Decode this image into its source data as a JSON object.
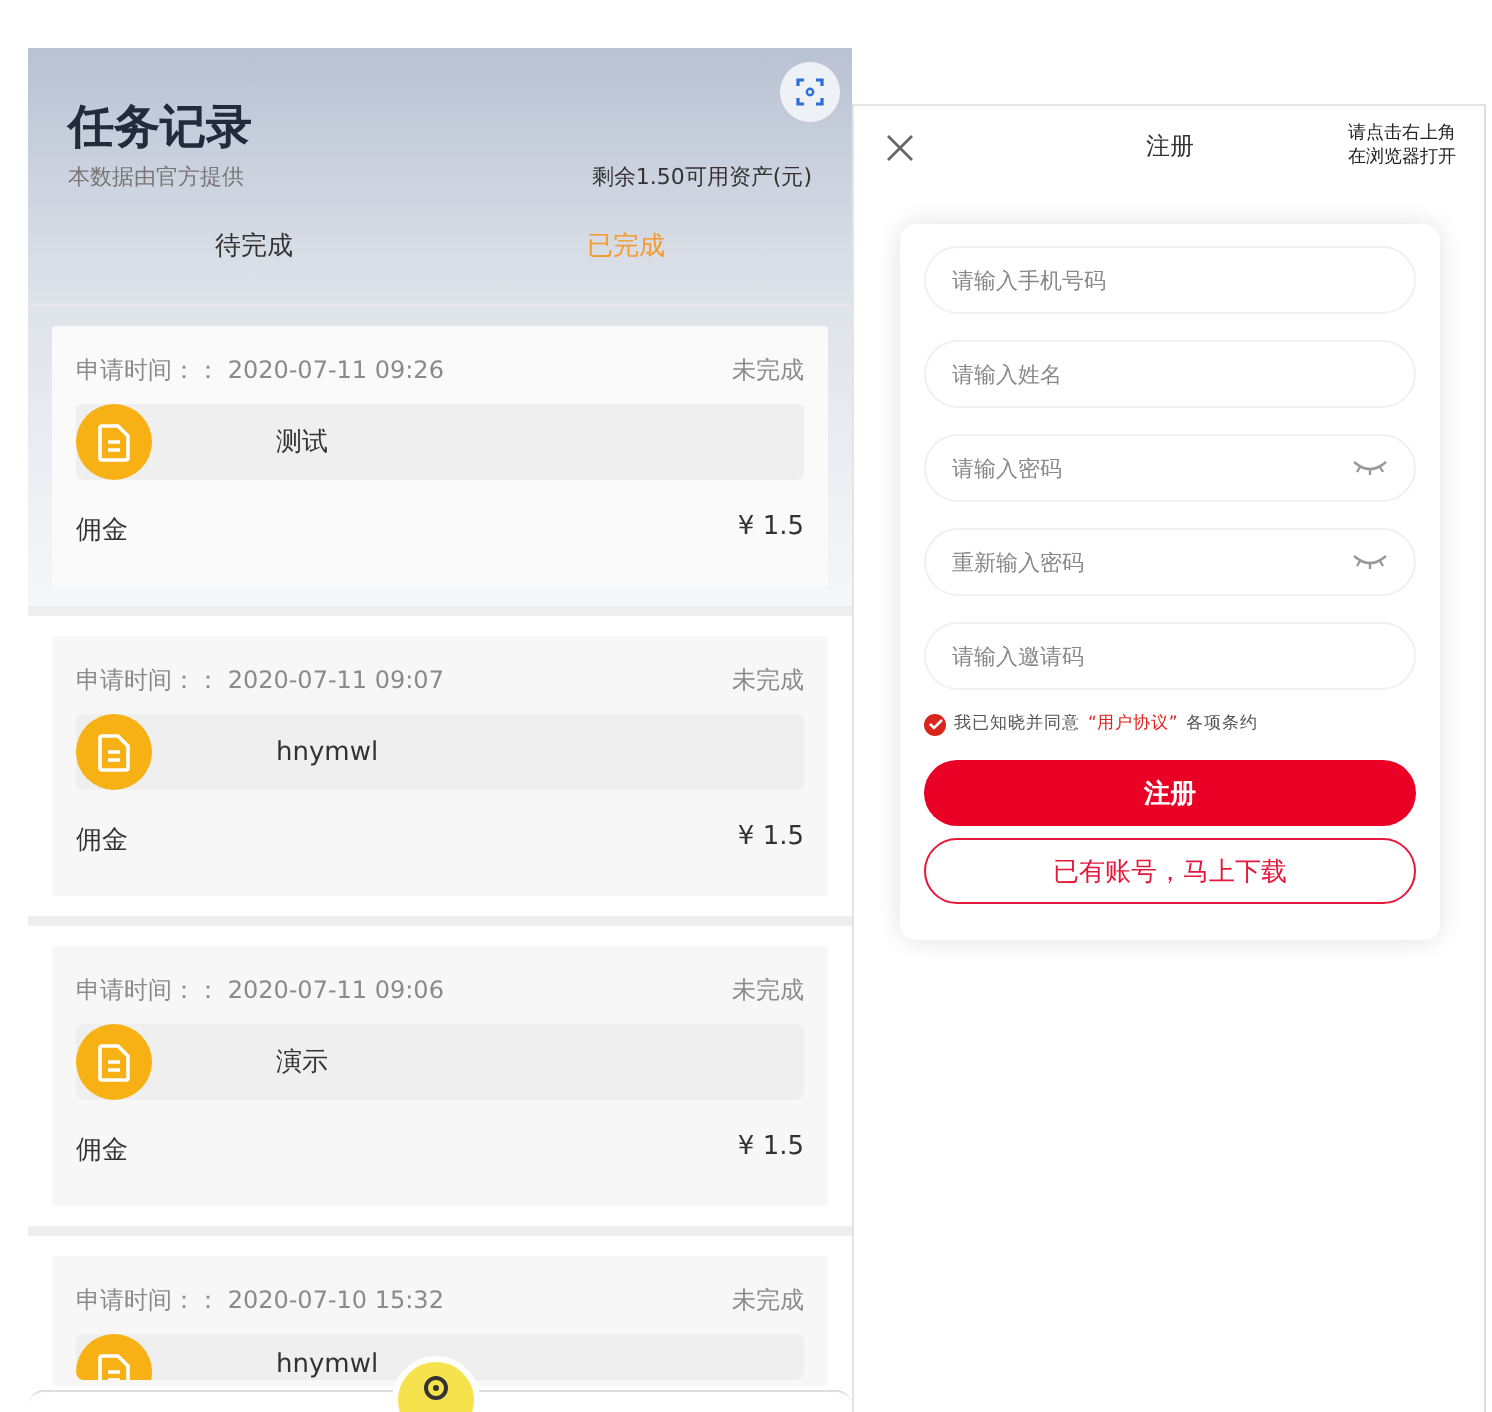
{
  "tasks_screen": {
    "title": "任务记录",
    "subtitle": "本数据由官方提供",
    "balance": "剩余1.50可用资产(元)",
    "tabs": [
      {
        "label": "待完成",
        "selected": false
      },
      {
        "label": "已完成",
        "selected": true
      }
    ],
    "tasks": [
      {
        "time": "申请时间：： 2020-07-11 09:26",
        "status": "未完成",
        "name": "测试",
        "commission_label": "佣金",
        "amount": "¥ 1.5"
      },
      {
        "time": "申请时间：： 2020-07-11 09:07",
        "status": "未完成",
        "name": "hnymwl",
        "commission_label": "佣金",
        "amount": "¥ 1.5"
      },
      {
        "time": "申请时间：： 2020-07-11 09:06",
        "status": "未完成",
        "name": "演示",
        "commission_label": "佣金",
        "amount": "¥ 1.5"
      },
      {
        "time": "申请时间：： 2020-07-10 15:32",
        "status": "未完成",
        "name": "hnymwl"
      }
    ]
  },
  "register_screen": {
    "title": "注册",
    "hint": [
      "请点击右上角",
      "在浏览器打开"
    ],
    "fields": [
      {
        "kind": "text",
        "placeholder": "请输入手机号码"
      },
      {
        "kind": "text",
        "placeholder": "请输入姓名"
      },
      {
        "kind": "password",
        "placeholder": "请输入密码"
      },
      {
        "kind": "password",
        "placeholder": "重新输入密码"
      },
      {
        "kind": "text",
        "placeholder": "请输入邀请码"
      }
    ],
    "agreement": {
      "checked": true,
      "before": "我已知晓并同意",
      "link": "“用户协议”",
      "after": "各项条约"
    },
    "buttons": [
      {
        "kind": "primary",
        "label": "注册"
      },
      {
        "kind": "outline",
        "label": "已有账号，马上下载"
      }
    ]
  }
}
